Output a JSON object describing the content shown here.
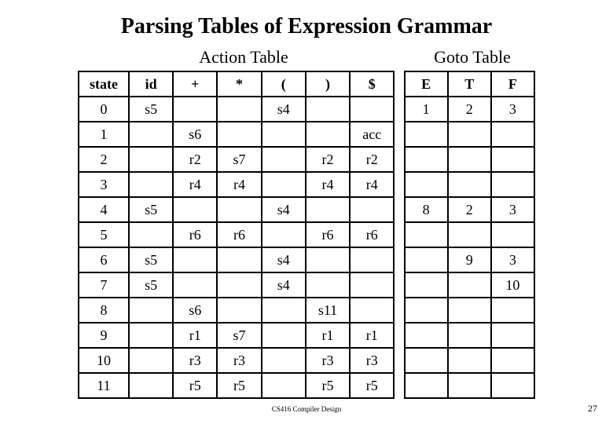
{
  "title": "Parsing Tables of Expression Grammar",
  "subheads": {
    "action": "Action Table",
    "goto": "Goto Table"
  },
  "headers": {
    "state": "state",
    "action": [
      "id",
      "+",
      "*",
      "(",
      ")",
      "$"
    ],
    "goto": [
      "E",
      "T",
      "F"
    ]
  },
  "rows": [
    {
      "state": "0",
      "action": [
        "s5",
        "",
        "",
        "s4",
        "",
        ""
      ],
      "goto": [
        "1",
        "2",
        "3"
      ]
    },
    {
      "state": "1",
      "action": [
        "",
        "s6",
        "",
        "",
        "",
        "acc"
      ],
      "goto": [
        "",
        "",
        ""
      ]
    },
    {
      "state": "2",
      "action": [
        "",
        "r2",
        "s7",
        "",
        "r2",
        "r2"
      ],
      "goto": [
        "",
        "",
        ""
      ]
    },
    {
      "state": "3",
      "action": [
        "",
        "r4",
        "r4",
        "",
        "r4",
        "r4"
      ],
      "goto": [
        "",
        "",
        ""
      ]
    },
    {
      "state": "4",
      "action": [
        "s5",
        "",
        "",
        "s4",
        "",
        ""
      ],
      "goto": [
        "8",
        "2",
        "3"
      ]
    },
    {
      "state": "5",
      "action": [
        "",
        "r6",
        "r6",
        "",
        "r6",
        "r6"
      ],
      "goto": [
        "",
        "",
        ""
      ]
    },
    {
      "state": "6",
      "action": [
        "s5",
        "",
        "",
        "s4",
        "",
        ""
      ],
      "goto": [
        "",
        "9",
        "3"
      ]
    },
    {
      "state": "7",
      "action": [
        "s5",
        "",
        "",
        "s4",
        "",
        ""
      ],
      "goto": [
        "",
        "",
        "10"
      ]
    },
    {
      "state": "8",
      "action": [
        "",
        "s6",
        "",
        "",
        "s11",
        ""
      ],
      "goto": [
        "",
        "",
        ""
      ]
    },
    {
      "state": "9",
      "action": [
        "",
        "r1",
        "s7",
        "",
        "r1",
        "r1"
      ],
      "goto": [
        "",
        "",
        ""
      ]
    },
    {
      "state": "10",
      "action": [
        "",
        "r3",
        "r3",
        "",
        "r3",
        "r3"
      ],
      "goto": [
        "",
        "",
        ""
      ]
    },
    {
      "state": "11",
      "action": [
        "",
        "r5",
        "r5",
        "",
        "r5",
        "r5"
      ],
      "goto": [
        "",
        "",
        ""
      ]
    }
  ],
  "footer": {
    "center": "CS416 Compiler Design",
    "page": "27"
  },
  "chart_data": {
    "type": "table",
    "title": "Parsing Tables of Expression Grammar",
    "sections": [
      "Action Table",
      "Goto Table"
    ],
    "columns": [
      "state",
      "id",
      "+",
      "*",
      "(",
      ")",
      "$",
      "E",
      "T",
      "F"
    ],
    "rows": [
      [
        "0",
        "s5",
        "",
        "",
        "s4",
        "",
        "",
        "1",
        "2",
        "3"
      ],
      [
        "1",
        "",
        "s6",
        "",
        "",
        "",
        "acc",
        "",
        "",
        ""
      ],
      [
        "2",
        "",
        "r2",
        "s7",
        "",
        "r2",
        "r2",
        "",
        "",
        ""
      ],
      [
        "3",
        "",
        "r4",
        "r4",
        "",
        "r4",
        "r4",
        "",
        "",
        ""
      ],
      [
        "4",
        "s5",
        "",
        "",
        "s4",
        "",
        "",
        "8",
        "2",
        "3"
      ],
      [
        "5",
        "",
        "r6",
        "r6",
        "",
        "r6",
        "r6",
        "",
        "",
        ""
      ],
      [
        "6",
        "s5",
        "",
        "",
        "s4",
        "",
        "",
        "",
        "9",
        "3"
      ],
      [
        "7",
        "s5",
        "",
        "",
        "s4",
        "",
        "",
        "",
        "",
        "10"
      ],
      [
        "8",
        "",
        "s6",
        "",
        "",
        "s11",
        "",
        "",
        "",
        ""
      ],
      [
        "9",
        "",
        "r1",
        "s7",
        "",
        "r1",
        "r1",
        "",
        "",
        ""
      ],
      [
        "10",
        "",
        "r3",
        "r3",
        "",
        "r3",
        "r3",
        "",
        "",
        ""
      ],
      [
        "11",
        "",
        "r5",
        "r5",
        "",
        "r5",
        "r5",
        "",
        "",
        ""
      ]
    ]
  }
}
